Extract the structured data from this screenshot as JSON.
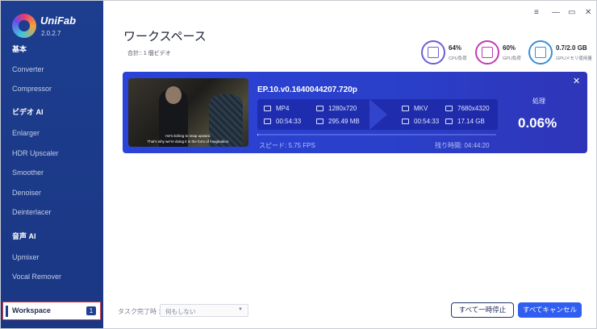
{
  "app": {
    "brand": "UniFab",
    "version": "2.0.2.7"
  },
  "sidebar": {
    "sections": [
      {
        "title": "基本",
        "items": [
          "Converter",
          "Compressor"
        ]
      },
      {
        "title": "ビデオ AI",
        "items": [
          "Enlarger",
          "HDR Upscaler",
          "Smoother",
          "Denoiser",
          "Deinterlacer"
        ]
      },
      {
        "title": "音声 AI",
        "items": [
          "Upmixer",
          "Vocal Remover"
        ]
      }
    ],
    "workspace": {
      "label": "Workspace",
      "badge": "1"
    }
  },
  "window": {
    "menu": "≡",
    "minimize": "—",
    "maximize": "▭",
    "close": "✕"
  },
  "header": {
    "title": "ワークスペース",
    "subtitle": "合計:: 1 個ビデオ",
    "stats": [
      {
        "value": "64%",
        "label": "CPU負荷",
        "icon": "cpu-icon",
        "color": "#6a5fd6"
      },
      {
        "value": "60%",
        "label": "GPU負荷",
        "icon": "amd-gpu-icon",
        "color": "#c23cb4"
      },
      {
        "value": "0.7/2.0 GB",
        "label": "GPUメモリ使用量",
        "icon": "memory-icon",
        "color": "#3c8ed6"
      }
    ]
  },
  "task": {
    "filename": "EP.10.v0.1640044207.720p",
    "subtitle_line1": "He's itching to snap upward.",
    "subtitle_line2": "That's why we're doing it in the form of imagination.",
    "source": {
      "format": "MP4",
      "resolution": "1280x720",
      "duration": "00:54:33",
      "size": "295.49 MB"
    },
    "target": {
      "format": "MKV",
      "resolution": "7680x4320",
      "duration": "00:54:33",
      "size": "17.14 GB"
    },
    "speed_label": "スピード: 5.75  FPS",
    "remaining_label": "残り時間: 04:44:20",
    "progress_fraction": 0.0006,
    "processing_label": "処理",
    "percent": "0.06%",
    "close": "✕"
  },
  "footer": {
    "after_label": "タスク完了時 :",
    "after_value": "何もしない",
    "pause_all": "すべて一時停止",
    "cancel_all": "すべてキャンセル"
  },
  "colors": {
    "sidebar": "#1d3d8f",
    "card": "#2a43d8",
    "accent": "#2f5ef0",
    "highlight": "#e2373d"
  }
}
